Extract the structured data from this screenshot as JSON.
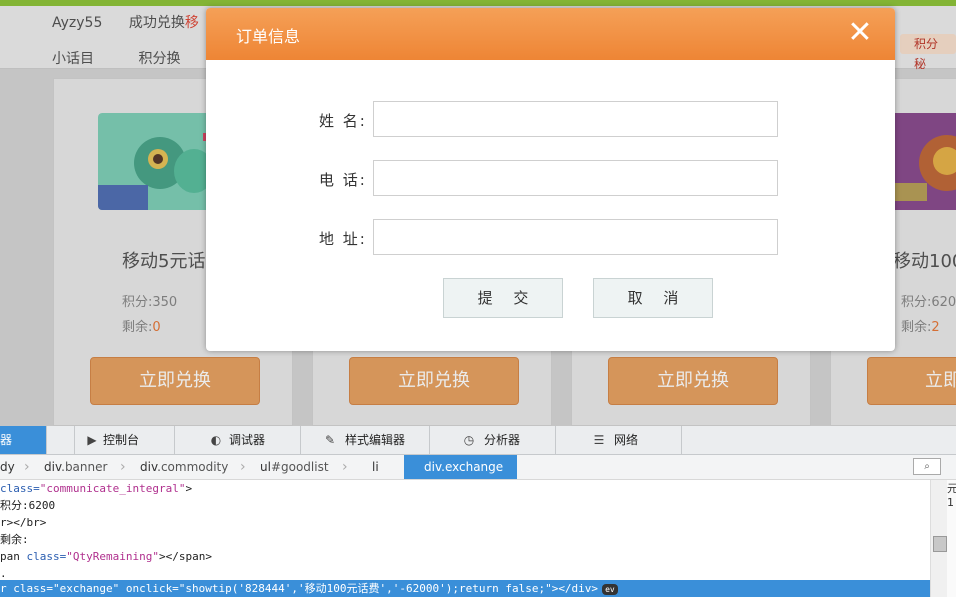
{
  "header": {
    "user_partial": "Ayzy55",
    "notice_partial": "成功兑换",
    "notice_red": "移",
    "row2_partial": "小话目",
    "row2_mid": "积分换",
    "points_secret": "积分秘"
  },
  "products": [
    {
      "name": "移动5元话",
      "points_label": "积分:",
      "points": "350",
      "remaining_label": "剩余:",
      "remaining": "0",
      "button": "立即兑换"
    },
    {
      "name": "",
      "points_label": "",
      "points": "",
      "remaining_label": "",
      "remaining": "",
      "button": "立即兑换"
    },
    {
      "name": "",
      "points_label": "",
      "points": "",
      "remaining_label": "",
      "remaining": "",
      "button": "立即兑换"
    },
    {
      "name": "移动100",
      "points_label": "积分:",
      "points": "620",
      "remaining_label": "剩余:",
      "remaining": "2",
      "button": "立即兑"
    }
  ],
  "dialog": {
    "title": "订单信息",
    "close": "✕",
    "name_label": "姓 名:",
    "phone_label": "电 话:",
    "address_label": "地 址:",
    "name_value": "",
    "phone_value": "",
    "address_value": "",
    "submit": "提 交",
    "cancel": "取 消"
  },
  "devtools": {
    "tabs": [
      {
        "label": "器",
        "icon": "inspector-icon"
      },
      {
        "label": "控制台",
        "icon": "console-icon"
      },
      {
        "label": "调试器",
        "icon": "debugger-icon"
      },
      {
        "label": "样式编辑器",
        "icon": "style-editor-icon"
      },
      {
        "label": "分析器",
        "icon": "profiler-icon"
      },
      {
        "label": "网络",
        "icon": "network-icon"
      }
    ],
    "breadcrumbs": [
      {
        "tag": "dy",
        "cls": ""
      },
      {
        "tag": "div",
        "cls": ".banner"
      },
      {
        "tag": "div",
        "cls": ".commodity"
      },
      {
        "tag": "ul",
        "cls": "#goodlist"
      },
      {
        "tag": "li",
        "cls": ""
      },
      {
        "tag": "div",
        "cls": ".exchange"
      }
    ],
    "search_icon": "⌕",
    "code": {
      "l1_attr": "class=",
      "l1_val": "\"communicate_integral\"",
      "l1_end": ">",
      "l2": "积分:6200",
      "l3": "r></br>",
      "l4": "剩余:",
      "l5_pre": "pan ",
      "l5_attr": "class=",
      "l5_val": "\"QtyRemaining\"",
      "l5_end": "></span>",
      "l6": ".",
      "l7": "r class=\"exchange\" onclick=\"showtip('828444','移动100元话费','-62000');return false;\"></div>",
      "ev_badge": "ev"
    },
    "side_text": "元 1"
  }
}
